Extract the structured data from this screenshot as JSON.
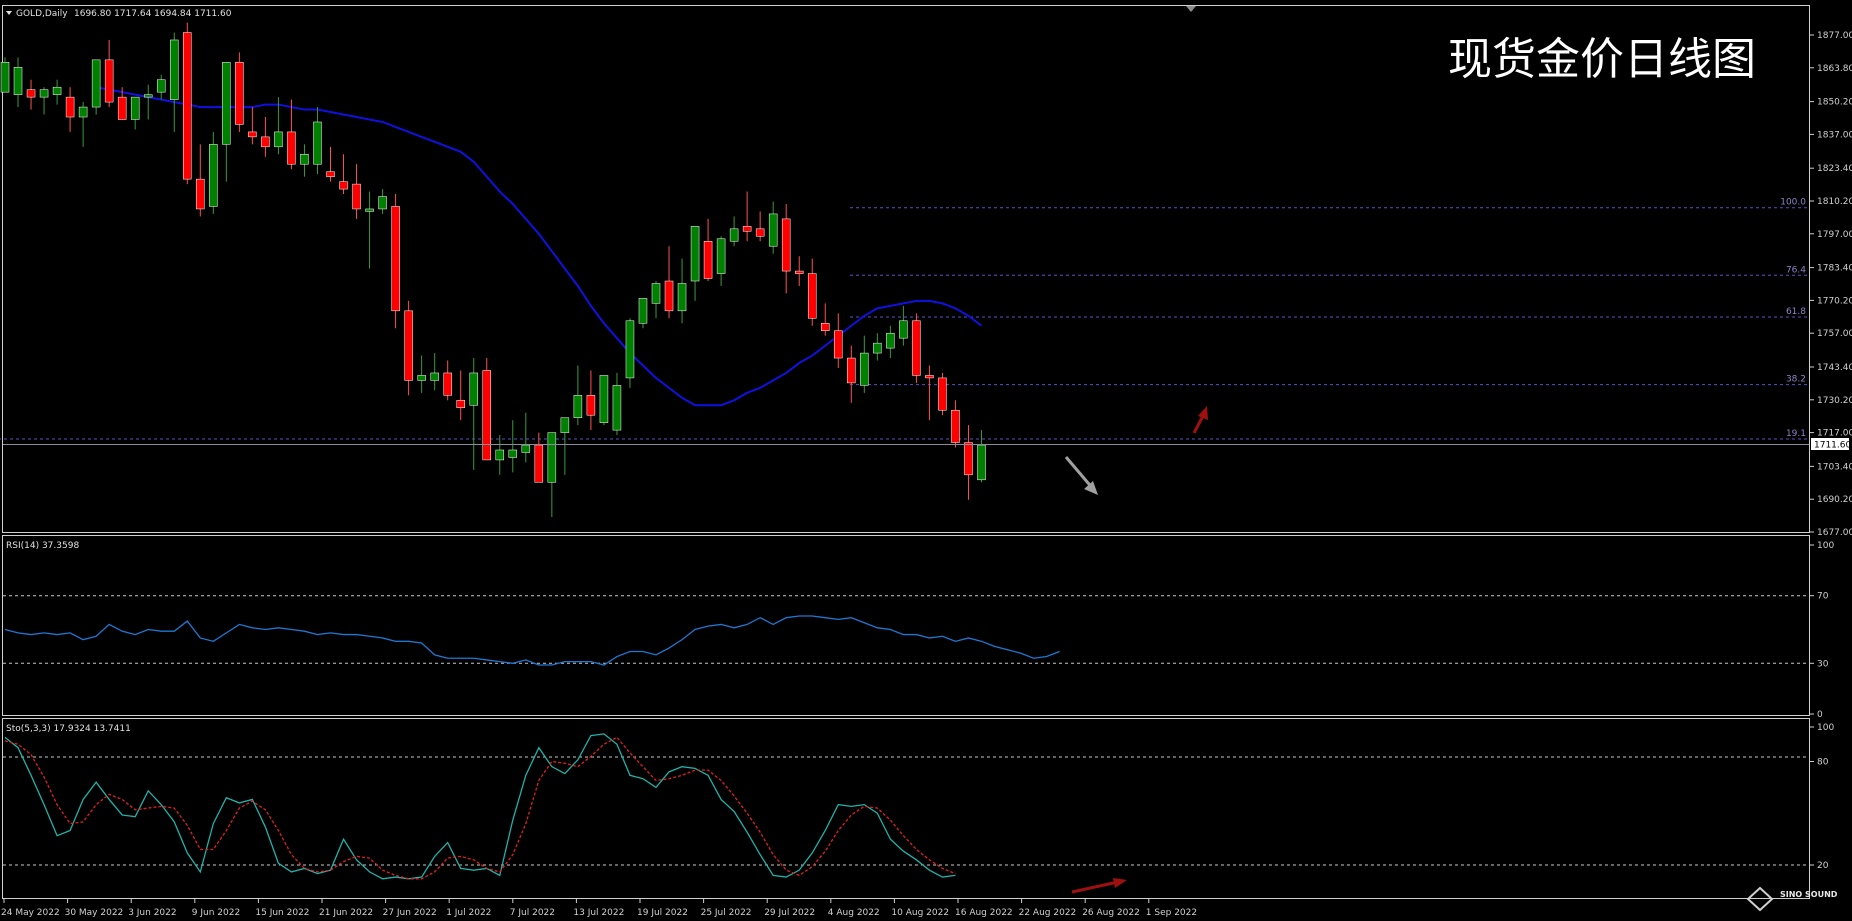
{
  "header": {
    "symbol": "GOLD,Daily",
    "ohlc": "1696.80 1717.64 1694.84 1711.60"
  },
  "watermark_title": "现货金价日线图",
  "logo_text": "SINO SOUND",
  "colors": {
    "bull": "#008000",
    "bear": "#ff0000",
    "ma": "#1010e0",
    "rsi": "#1e78d2",
    "sto_main": "#20b2aa",
    "sto_signal": "#e02020",
    "fib": "#5a50c8",
    "grid_dash": "#c8c8c8",
    "axis": "#d0d0d0"
  },
  "chart_data": [
    {
      "type": "candlestick",
      "title": "GOLD,Daily",
      "current_price": "1711.60",
      "ylim": [
        1677,
        1885
      ],
      "y_ticks": [
        "1877.00",
        "1863.80",
        "1850.20",
        "1837.00",
        "1823.40",
        "1810.20",
        "1797.00",
        "1783.40",
        "1770.20",
        "1757.00",
        "1743.40",
        "1730.20",
        "1717.00",
        "1703.40",
        "1690.20",
        "1677.00"
      ],
      "x_tick_labels": [
        "24 May 2022",
        "30 May 2022",
        "3 Jun 2022",
        "9 Jun 2022",
        "15 Jun 2022",
        "21 Jun 2022",
        "27 Jun 2022",
        "1 Jul 2022",
        "7 Jul 2022",
        "13 Jul 2022",
        "19 Jul 2022",
        "25 Jul 2022",
        "29 Jul 2022",
        "4 Aug 2022",
        "10 Aug 2022",
        "16 Aug 2022",
        "22 Aug 2022",
        "26 Aug 2022",
        "1 Sep 2022"
      ],
      "candles": [
        [
          1854,
          1868,
          1856,
          1866
        ],
        [
          1853,
          1868,
          1848,
          1864
        ],
        [
          1855,
          1859,
          1847,
          1852
        ],
        [
          1852,
          1856,
          1845,
          1855
        ],
        [
          1853,
          1859,
          1849,
          1856
        ],
        [
          1852,
          1856,
          1838,
          1844
        ],
        [
          1844,
          1850,
          1832,
          1848
        ],
        [
          1848,
          1864,
          1845,
          1867
        ],
        [
          1867,
          1875,
          1848,
          1850
        ],
        [
          1852,
          1856,
          1843,
          1843
        ],
        [
          1843,
          1852,
          1839,
          1852
        ],
        [
          1852,
          1857,
          1843,
          1853
        ],
        [
          1854,
          1861,
          1851,
          1859
        ],
        [
          1851,
          1878,
          1838,
          1875
        ],
        [
          1878,
          1882,
          1817,
          1819
        ],
        [
          1819,
          1833,
          1804,
          1807
        ],
        [
          1808,
          1838,
          1805,
          1833
        ],
        [
          1833,
          1866,
          1818,
          1866
        ],
        [
          1866,
          1870,
          1838,
          1841
        ],
        [
          1838,
          1848,
          1833,
          1836
        ],
        [
          1836,
          1844,
          1828,
          1832
        ],
        [
          1832,
          1852,
          1829,
          1838
        ],
        [
          1838,
          1851,
          1823,
          1825
        ],
        [
          1825,
          1833,
          1820,
          1829
        ],
        [
          1825,
          1848,
          1821,
          1842
        ],
        [
          1822,
          1832,
          1818,
          1820
        ],
        [
          1818,
          1829,
          1813,
          1815
        ],
        [
          1817,
          1825,
          1803,
          1807
        ],
        [
          1806,
          1814,
          1783,
          1807
        ],
        [
          1807,
          1815,
          1805,
          1812
        ],
        [
          1808,
          1813,
          1759,
          1766
        ],
        [
          1766,
          1770,
          1732,
          1738
        ],
        [
          1738,
          1748,
          1733,
          1740
        ],
        [
          1738,
          1749,
          1734,
          1741
        ],
        [
          1741,
          1746,
          1730,
          1732
        ],
        [
          1730,
          1742,
          1722,
          1727
        ],
        [
          1728,
          1747,
          1702,
          1741
        ],
        [
          1742,
          1747,
          1710,
          1706
        ],
        [
          1706,
          1716,
          1700,
          1710
        ],
        [
          1707,
          1722,
          1701,
          1710
        ],
        [
          1709,
          1725,
          1705,
          1712
        ],
        [
          1712,
          1717,
          1698,
          1697
        ],
        [
          1697,
          1717,
          1683,
          1717
        ],
        [
          1717,
          1723,
          1700,
          1723
        ],
        [
          1723,
          1744,
          1720,
          1732
        ],
        [
          1732,
          1742,
          1718,
          1724
        ],
        [
          1721,
          1738,
          1720,
          1740
        ],
        [
          1718,
          1741,
          1716,
          1736
        ],
        [
          1739,
          1763,
          1735,
          1762
        ],
        [
          1761,
          1771,
          1759,
          1771
        ],
        [
          1769,
          1778,
          1763,
          1777
        ],
        [
          1778,
          1792,
          1763,
          1766
        ],
        [
          1766,
          1787,
          1761,
          1777
        ],
        [
          1778,
          1800,
          1770,
          1800
        ],
        [
          1794,
          1803,
          1778,
          1779
        ],
        [
          1781,
          1796,
          1776,
          1795
        ],
        [
          1794,
          1804,
          1792,
          1799
        ],
        [
          1800,
          1814,
          1794,
          1798
        ],
        [
          1799,
          1806,
          1794,
          1796
        ],
        [
          1792,
          1810,
          1789,
          1805
        ],
        [
          1803,
          1809,
          1773,
          1782
        ],
        [
          1782,
          1788,
          1776,
          1781
        ],
        [
          1781,
          1787,
          1760,
          1763
        ],
        [
          1761,
          1769,
          1756,
          1758
        ],
        [
          1758,
          1765,
          1743,
          1747
        ],
        [
          1747,
          1752,
          1729,
          1737
        ],
        [
          1736,
          1756,
          1733,
          1749
        ],
        [
          1749,
          1757,
          1746,
          1753
        ],
        [
          1751,
          1760,
          1747,
          1757
        ],
        [
          1755,
          1768,
          1752,
          1762
        ],
        [
          1762,
          1765,
          1737,
          1740
        ],
        [
          1740,
          1744,
          1722,
          1739
        ],
        [
          1739,
          1741,
          1724,
          1726
        ],
        [
          1726,
          1730,
          1711,
          1713
        ],
        [
          1713,
          1720,
          1690,
          1700
        ],
        [
          1698,
          1718,
          1697,
          1712
        ]
      ],
      "ma_line": [
        1856,
        1855,
        1854,
        1853,
        1852,
        1851,
        1850,
        1849,
        1848,
        1848,
        1848,
        1848,
        1848,
        1849,
        1849,
        1848,
        1847,
        1847,
        1846,
        1845,
        1844,
        1843,
        1842,
        1840,
        1838,
        1836,
        1834,
        1832,
        1830,
        1826,
        1820,
        1814,
        1809,
        1803,
        1797,
        1790,
        1783,
        1776,
        1768,
        1761,
        1755,
        1749,
        1744,
        1739,
        1735,
        1731,
        1728,
        1728,
        1728,
        1730,
        1733,
        1735,
        1738,
        1741,
        1745,
        1748,
        1752,
        1756,
        1760,
        1764,
        1767,
        1768,
        1769,
        1770,
        1770,
        1769,
        1767,
        1764,
        1760
      ],
      "fib_levels": [
        {
          "label": "100.0",
          "price": 1807.5
        },
        {
          "label": "76.4",
          "price": 1780.3
        },
        {
          "label": "61.8",
          "price": 1763.5
        },
        {
          "label": "38.2",
          "price": 1736.3
        },
        {
          "label": "19.1",
          "price": 1714.4
        }
      ]
    },
    {
      "type": "line",
      "title": "RSI(14) 37.3598",
      "ylim": [
        0,
        100
      ],
      "y_ticks": [
        "100",
        "70",
        "30",
        "0"
      ],
      "levels": [
        70,
        30
      ],
      "values": [
        50,
        48,
        47,
        48,
        47,
        48,
        44,
        46,
        53,
        49,
        47,
        50,
        49,
        49,
        55,
        45,
        43,
        48,
        53,
        51,
        50,
        51,
        50,
        49,
        47,
        48,
        47,
        47,
        46,
        45,
        43,
        43,
        42,
        35,
        33,
        33,
        33,
        32,
        31,
        30,
        32,
        29,
        29,
        31,
        31,
        31,
        29,
        34,
        37,
        37,
        35,
        39,
        44,
        50,
        52,
        53,
        51,
        53,
        57,
        53,
        57,
        58,
        58,
        57,
        56,
        57,
        54,
        51,
        50,
        47,
        47,
        45,
        46,
        43,
        45,
        43,
        40,
        38,
        36,
        33,
        34,
        37
      ]
    },
    {
      "type": "line",
      "title": "Sto(5,3,3) 17.9324 13.7411",
      "ylim": [
        0,
        100
      ],
      "y_ticks": [
        "100",
        "80",
        "20"
      ],
      "levels": [
        80,
        20
      ],
      "series": [
        {
          "name": "main",
          "values": [
            94,
            88,
            72,
            55,
            37,
            40,
            58,
            68,
            58,
            49,
            48,
            63,
            55,
            45,
            27,
            16,
            44,
            59,
            56,
            58,
            42,
            21,
            16,
            18,
            15,
            17,
            35,
            23,
            16,
            12,
            13,
            12,
            13,
            25,
            33,
            18,
            17,
            18,
            14,
            46,
            72,
            88,
            77,
            73,
            81,
            95,
            96,
            90,
            72,
            70,
            65,
            74,
            77,
            76,
            72,
            58,
            51,
            39,
            26,
            14,
            13,
            17,
            27,
            40,
            55,
            54,
            55,
            50,
            35,
            28,
            23,
            17,
            13,
            14
          ]
        },
        {
          "name": "signal",
          "values": [
            92,
            90,
            84,
            71,
            55,
            44,
            45,
            55,
            61,
            58,
            52,
            53,
            54,
            53,
            43,
            29,
            29,
            40,
            53,
            57,
            52,
            40,
            26,
            18,
            16,
            17,
            22,
            25,
            24,
            17,
            14,
            12,
            12,
            16,
            24,
            25,
            23,
            18,
            16,
            26,
            44,
            69,
            80,
            79,
            77,
            83,
            90,
            94,
            85,
            77,
            69,
            70,
            72,
            75,
            75,
            69,
            60,
            50,
            39,
            26,
            17,
            14,
            19,
            28,
            40,
            49,
            54,
            53,
            46,
            37,
            29,
            23,
            18,
            15
          ]
        }
      ]
    }
  ]
}
